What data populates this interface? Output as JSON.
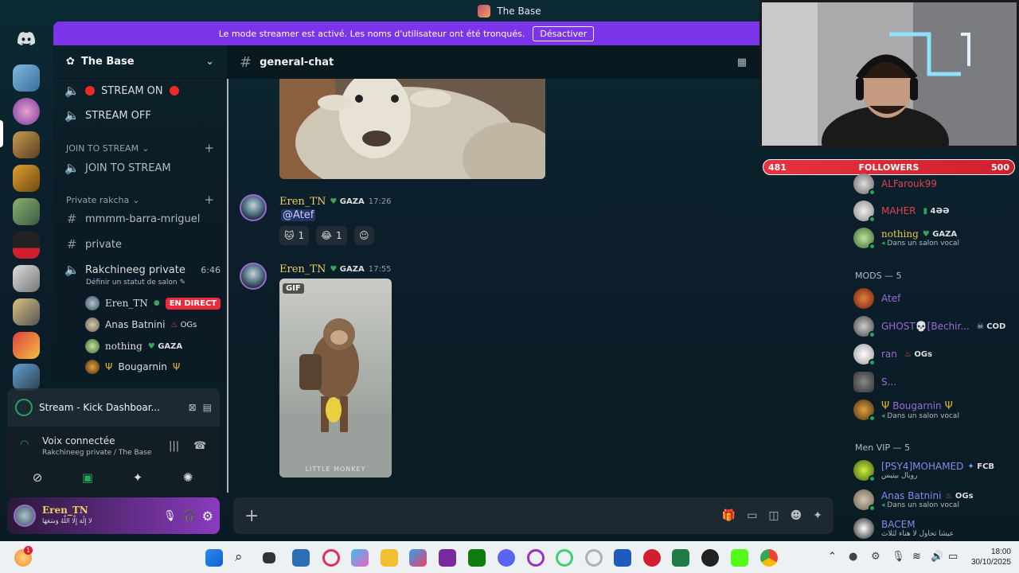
{
  "window": {
    "title": "The Base"
  },
  "banner": {
    "text": "Le mode streamer est activé. Les noms d'utilisateur ont été tronqués.",
    "button": "Désactiver"
  },
  "server": {
    "name": "The Base"
  },
  "channels": {
    "stream_on": "STREAM ON",
    "stream_off": "STREAM OFF",
    "cat_join": "JOIN TO STREAM",
    "join_to_stream": "JOIN TO STREAM",
    "cat_private": "Private rakcha",
    "mmmm": "mmmm-barra-mriguel",
    "private": "private",
    "rakchineeg": "Rakchineeg private",
    "rakchineeg_time": "6:46",
    "rakchineeg_status": "Définir un statut de salon"
  },
  "voice_users": [
    {
      "name": "Eren_TN",
      "badge": "EN DIRECT"
    },
    {
      "name": "Anas Batnini",
      "tag": "OGs"
    },
    {
      "name": "nothing",
      "tag": "GAZA"
    },
    {
      "name": "Bougarnin",
      "tag": ""
    }
  ],
  "stream_panel": {
    "label": "Stream - Kick Dashboar..."
  },
  "voice_panel": {
    "title": "Voix connectée",
    "subtitle": "Rakchineeg private / The Base"
  },
  "user_panel": {
    "name": "Eren_TN",
    "status": "لا إِلَٰهَ إِلَّا اللَّهُ وَسَعَهَا"
  },
  "chat": {
    "channel": "general-chat",
    "messages": [
      {
        "author": "Eren_TN",
        "tag": "GAZA",
        "time": "17:26",
        "mention": "@Atef",
        "reactions": [
          {
            "emoji": "🐱",
            "count": "1"
          },
          {
            "emoji": "😂",
            "count": "1"
          }
        ]
      },
      {
        "author": "Eren_TN",
        "tag": "GAZA",
        "time": "17:55",
        "gif_label": "GIF",
        "gif_caption": "LITTLE MONKEY"
      }
    ]
  },
  "followers": {
    "current": "481",
    "label": "FOLLOWERS",
    "goal": "500"
  },
  "members": {
    "top": [
      {
        "name": "ALFarouk99",
        "color": "#e0434b"
      },
      {
        "name": "MAHER",
        "color": "#e0434b",
        "tag": "4ƏƏ"
      },
      {
        "name": "nothing",
        "color": "#e8c94a",
        "tag": "GAZA",
        "sub": "Dans un salon vocal"
      }
    ],
    "mods_header": "MODS — 5",
    "mods": [
      {
        "name": "Atef",
        "color": "#9b6ad9"
      },
      {
        "name": "GHOST💀[Bechir...",
        "color": "#9b6ad9",
        "tag": "COD"
      },
      {
        "name": "ran",
        "color": "#9b6ad9",
        "tag": "OGs"
      },
      {
        "name": "S...",
        "color": "#9b6ad9"
      },
      {
        "name": "Bougarnin",
        "color": "#9b6ad9",
        "sub": "Dans un salon vocal"
      }
    ],
    "vip_header": "Men VIP — 5",
    "vip": [
      {
        "name": "[PSY4]MOHAMED",
        "color": "#8b86f0",
        "tag": "FCB",
        "sub": "رويال بيتيس"
      },
      {
        "name": "Anas Batnini",
        "color": "#8b86f0",
        "tag": "OGs",
        "sub": "Dans un salon vocal"
      },
      {
        "name": "BACEM",
        "color": "#8b86f0",
        "sub": "عيشا تحاول لا هناء لثلاث"
      }
    ]
  },
  "taskbar": {
    "time": "18:00",
    "date": "30/10/2025",
    "notification_count": "1"
  },
  "colors": {
    "accent": "#7b34e7",
    "live": "#ed2a3d",
    "followers": "#e8323f"
  }
}
